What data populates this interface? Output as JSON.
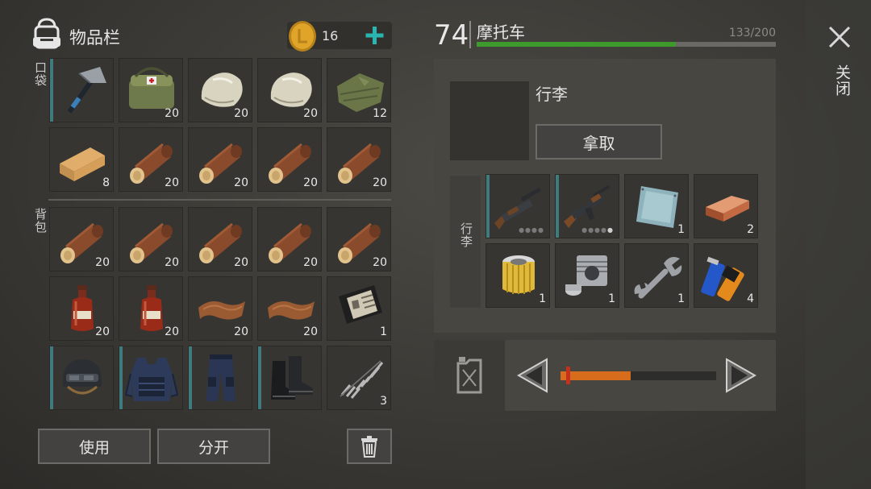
{
  "inventory": {
    "title": "物品栏",
    "coin_count": "16",
    "pocket_label": "口袋",
    "backpack_label": "背包",
    "pocket_slots": [
      {
        "icon": "hatchet-icon",
        "qty": "",
        "accent": true
      },
      {
        "icon": "first-aid-bag-icon",
        "qty": "20",
        "accent": false
      },
      {
        "icon": "stone-icon",
        "qty": "20",
        "accent": false
      },
      {
        "icon": "stone-icon",
        "qty": "20",
        "accent": false
      },
      {
        "icon": "cloth-icon",
        "qty": "12",
        "accent": false
      },
      {
        "icon": "plank-icon",
        "qty": "8",
        "accent": false
      },
      {
        "icon": "log-icon",
        "qty": "20",
        "accent": false
      },
      {
        "icon": "log-icon",
        "qty": "20",
        "accent": false
      },
      {
        "icon": "log-icon",
        "qty": "20",
        "accent": false
      },
      {
        "icon": "log-icon",
        "qty": "20",
        "accent": false
      }
    ],
    "backpack_slots": [
      {
        "icon": "log-icon",
        "qty": "20",
        "accent": false
      },
      {
        "icon": "log-icon",
        "qty": "20",
        "accent": false
      },
      {
        "icon": "log-icon",
        "qty": "20",
        "accent": false
      },
      {
        "icon": "log-icon",
        "qty": "20",
        "accent": false
      },
      {
        "icon": "log-icon",
        "qty": "20",
        "accent": false
      },
      {
        "icon": "bottle-icon",
        "qty": "20",
        "accent": false
      },
      {
        "icon": "bottle-icon",
        "qty": "20",
        "accent": false
      },
      {
        "icon": "leather-icon",
        "qty": "20",
        "accent": false
      },
      {
        "icon": "leather-icon",
        "qty": "20",
        "accent": false
      },
      {
        "icon": "wallet-icon",
        "qty": "1",
        "accent": false
      },
      {
        "icon": "helmet-icon",
        "qty": "",
        "accent": true
      },
      {
        "icon": "armor-vest-icon",
        "qty": "",
        "accent": true
      },
      {
        "icon": "pants-icon",
        "qty": "",
        "accent": true
      },
      {
        "icon": "boots-icon",
        "qty": "",
        "accent": true
      },
      {
        "icon": "spring-icon",
        "qty": "3",
        "accent": false
      }
    ],
    "use_label": "使用",
    "split_label": "分开"
  },
  "vehicle": {
    "level": "74",
    "name": "摩托车",
    "durability_text": "133/200",
    "durability_fraction": 0.665,
    "trunk_name": "行李",
    "take_label": "拿取",
    "trunk_label": "行李",
    "trunk_slots": [
      {
        "icon": "shotgun-icon",
        "qty": "",
        "accent": true,
        "dots": 4,
        "dots_on": 0
      },
      {
        "icon": "rifle-icon",
        "qty": "",
        "accent": true,
        "dots": 5,
        "dots_on": 1
      },
      {
        "icon": "metal-plate-icon",
        "qty": "1",
        "accent": false
      },
      {
        "icon": "copper-ingot-icon",
        "qty": "2",
        "accent": false
      },
      {
        "icon": "air-filter-icon",
        "qty": "1",
        "accent": false
      },
      {
        "icon": "engine-cylinder-icon",
        "qty": "1",
        "accent": false
      },
      {
        "icon": "wrench-icon",
        "qty": "1",
        "accent": false
      },
      {
        "icon": "batteries-icon",
        "qty": "4",
        "accent": false
      }
    ],
    "fuel_fraction": 0.45
  },
  "close_label": "关闭",
  "colors": {
    "accent": "#3f7a7f",
    "durability": "#3f9a2e",
    "fuel": "#d76c1c",
    "coin": "#e0a429",
    "plus": "#2bb5b1"
  }
}
